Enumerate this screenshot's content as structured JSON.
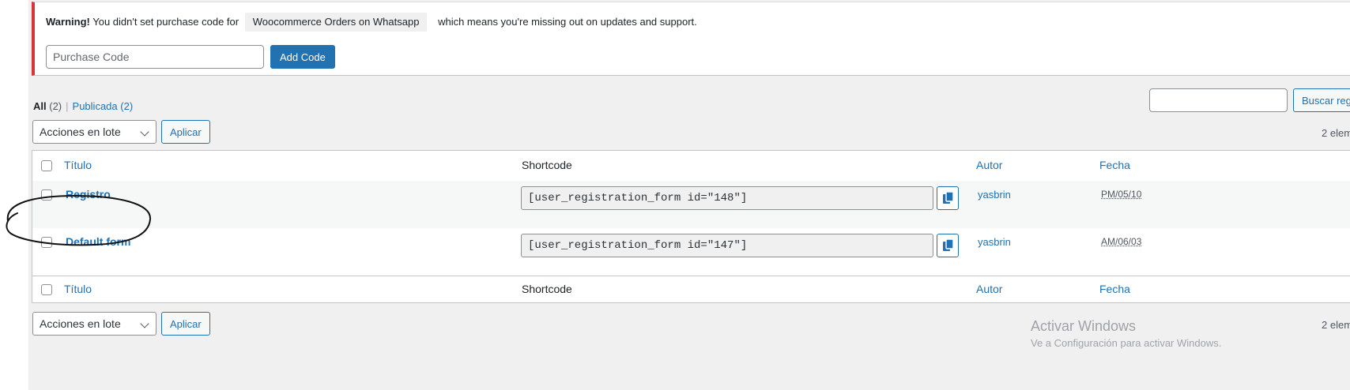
{
  "notice": {
    "warning_label": "Warning!",
    "text_before": "You didn't set purchase code for",
    "plugin_name": "Woocommerce Orders on Whatsapp",
    "text_after": "which means you're missing out on updates and support.",
    "purchase_placeholder": "Purchase Code",
    "add_code_label": "Add Code"
  },
  "views": {
    "all_label": "All",
    "all_count": "(2)",
    "separator": "|",
    "published_label": "Publicada",
    "published_count": "(2)"
  },
  "search": {
    "value": "",
    "button_label": "Buscar regi"
  },
  "tablenav": {
    "bulk_action": "Acciones en lote",
    "apply_label": "Aplicar",
    "items_count": "2 elem"
  },
  "table": {
    "columns": {
      "title": "Título",
      "shortcode": "Shortcode",
      "author": "Autor",
      "date": "Fecha"
    },
    "rows": [
      {
        "title": "Registro",
        "shortcode": "[user_registration_form id=\"148\"]",
        "author": "yasbrin",
        "date": "PM/05/10"
      },
      {
        "title": "Default form",
        "shortcode": "[user_registration_form id=\"147\"]",
        "author": "yasbrin",
        "date": "AM/06/03"
      }
    ]
  },
  "watermark": {
    "title": "Activar Windows",
    "subtitle": "Ve a Configuración para activar Windows."
  },
  "colors": {
    "accent": "#2271b1",
    "warning_border": "#d63638",
    "background": "#f0f0f1"
  }
}
